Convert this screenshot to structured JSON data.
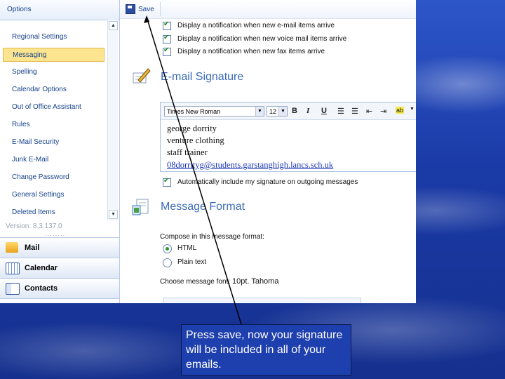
{
  "nav": {
    "header": "Options",
    "items": [
      {
        "label": "Regional Settings",
        "selected": false
      },
      {
        "label": "Messaging",
        "selected": true
      },
      {
        "label": "Spelling",
        "selected": false
      },
      {
        "label": "Calendar Options",
        "selected": false
      },
      {
        "label": "Out of Office Assistant",
        "selected": false
      },
      {
        "label": "Rules",
        "selected": false
      },
      {
        "label": "E-Mail Security",
        "selected": false
      },
      {
        "label": "Junk E-Mail",
        "selected": false
      },
      {
        "label": "Change Password",
        "selected": false
      },
      {
        "label": "General Settings",
        "selected": false
      },
      {
        "label": "Deleted Items",
        "selected": false
      }
    ],
    "version": "Version: 8.3.137.0",
    "buttons": {
      "mail": "Mail",
      "calendar": "Calendar",
      "contacts": "Contacts"
    }
  },
  "toolbar": {
    "save_label": "Save"
  },
  "notifications": {
    "email": "Display a notification when new e-mail items arrive",
    "voicemail": "Display a notification when new voice mail items arrive",
    "fax": "Display a notification when new fax items arrive"
  },
  "signature": {
    "title": "E-mail Signature",
    "font": "Times New Roman",
    "size": "12",
    "lines": [
      "george dorrity",
      "venture clothing",
      "staff trainer"
    ],
    "email": "08dorrityg@students.garstanghigh.lancs.sch.uk",
    "auto_include": "Automatically include my signature on outgoing messages"
  },
  "message_format": {
    "title": "Message Format",
    "compose_label": "Compose in this message format:",
    "options": [
      "HTML",
      "Plain text"
    ],
    "selected": "HTML",
    "font_label": "Choose message font:",
    "font_value": "10pt. Tahoma"
  },
  "callout": {
    "text": "Press save, now your signature will be included in all of your emails."
  },
  "colors": {
    "slide_bg": "#1b3aa8",
    "accent": "#3b6cb7",
    "selection": "#fde58f"
  }
}
